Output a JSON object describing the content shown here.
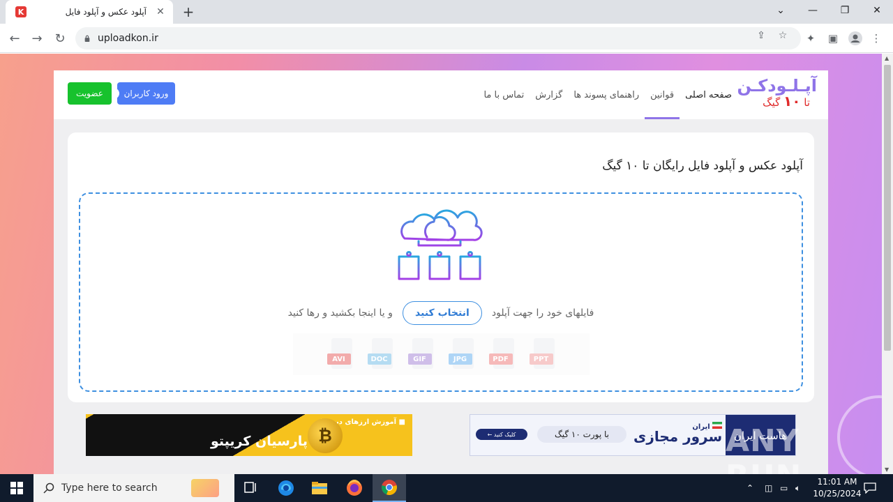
{
  "browser": {
    "tab_title": "آپلود عکس و آپلود فایل",
    "favicon_letter": "K",
    "url": "uploadkon.ir"
  },
  "site": {
    "logo_main": "آپـلـودکـن",
    "logo_sub_prefix": "تا",
    "logo_sub_number": "۱۰",
    "logo_sub_suffix": "گیگ",
    "nav": [
      "صفحه اصلی",
      "قوانین",
      "راهنمای پسوند ها",
      "گزارش",
      "تماس با ما"
    ],
    "login_button": "ورود کاربران",
    "signup_button": "عضویت",
    "card_title": "آپلود عکس و آپلود فایل رایگان تا ۱۰ گیگ",
    "drop_text_before": "فایلهای خود را جهت آپلود",
    "choose_button": "انتخاب کنید",
    "drop_text_after": "و یا اینجا بکشید و رها کنید",
    "file_types": [
      {
        "label": "PPT",
        "color": "#f2a0a0"
      },
      {
        "label": "PDF",
        "color": "#f08080"
      },
      {
        "label": "JPG",
        "color": "#6cb4f0"
      },
      {
        "label": "GIF",
        "color": "#a88ad8"
      },
      {
        "label": "DOC",
        "color": "#7ac0e8"
      },
      {
        "label": "AVI",
        "color": "#e86868"
      }
    ]
  },
  "ads": {
    "left_line1": "آموزش ارزهای دیجیتال",
    "left_line2a": "پارسیان",
    "left_line2b": "کریپتو",
    "left_coin_symbol": "₿",
    "right_brand": "هاست ایران",
    "right_product_small": "ایران",
    "right_product": "سرور مجازی",
    "right_pill": "با پورت ۱۰ گیگ",
    "right_button": "کلیک کنید"
  },
  "watermark": "ANY RUN",
  "taskbar": {
    "search_placeholder": "Type here to search",
    "time": "11:01 AM",
    "date": "10/25/2024"
  }
}
